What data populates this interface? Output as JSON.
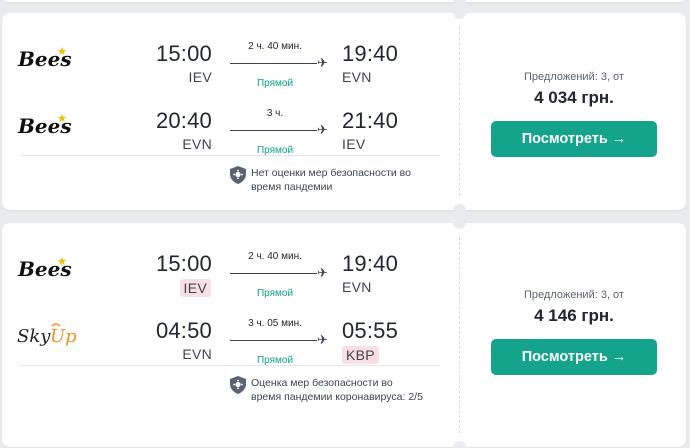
{
  "colors": {
    "accent": "#14a38b",
    "direct": "#0ea38a",
    "highlight": "#f9dfe3",
    "bees_star": "#e5c300",
    "skyup_orange": "#f39224"
  },
  "flights": [
    {
      "legs": [
        {
          "airline": "Bees",
          "dep_time": "15:00",
          "dep_code": "IEV",
          "arr_time": "19:40",
          "arr_code": "EVN",
          "duration": "2 ч. 40 мин.",
          "stops": "Прямой"
        },
        {
          "airline": "Bees",
          "dep_time": "20:40",
          "dep_code": "EVN",
          "arr_time": "21:40",
          "arr_code": "IEV",
          "duration": "3 ч.",
          "stops": "Прямой"
        }
      ],
      "safety_text": "Нет оценки мер безопасности во время пандемии",
      "offers": "Предложений: 3, от",
      "price": "4 034 грн.",
      "button": "Посмотреть →"
    },
    {
      "legs": [
        {
          "airline": "Bees",
          "dep_time": "15:00",
          "dep_code": "IEV",
          "arr_time": "19:40",
          "arr_code": "EVN",
          "duration": "2 ч. 40 мин.",
          "stops": "Прямой"
        },
        {
          "airline": "SkyUp",
          "dep_time": "04:50",
          "dep_code": "EVN",
          "arr_time": "05:55",
          "arr_code": "KBP",
          "duration": "3 ч. 05 мин.",
          "stops": "Прямой"
        }
      ],
      "safety_text": "Оценка мер безопасности во время пандемии коронавируса: 2/5",
      "offers": "Предложений: 3, от",
      "price": "4 146 грн.",
      "button": "Посмотреть →"
    }
  ],
  "icons": {
    "bees_logo": "bees-logo",
    "skyup_logo": "skyup-logo",
    "plane": "plane-icon",
    "shield": "shield-virus-icon"
  }
}
